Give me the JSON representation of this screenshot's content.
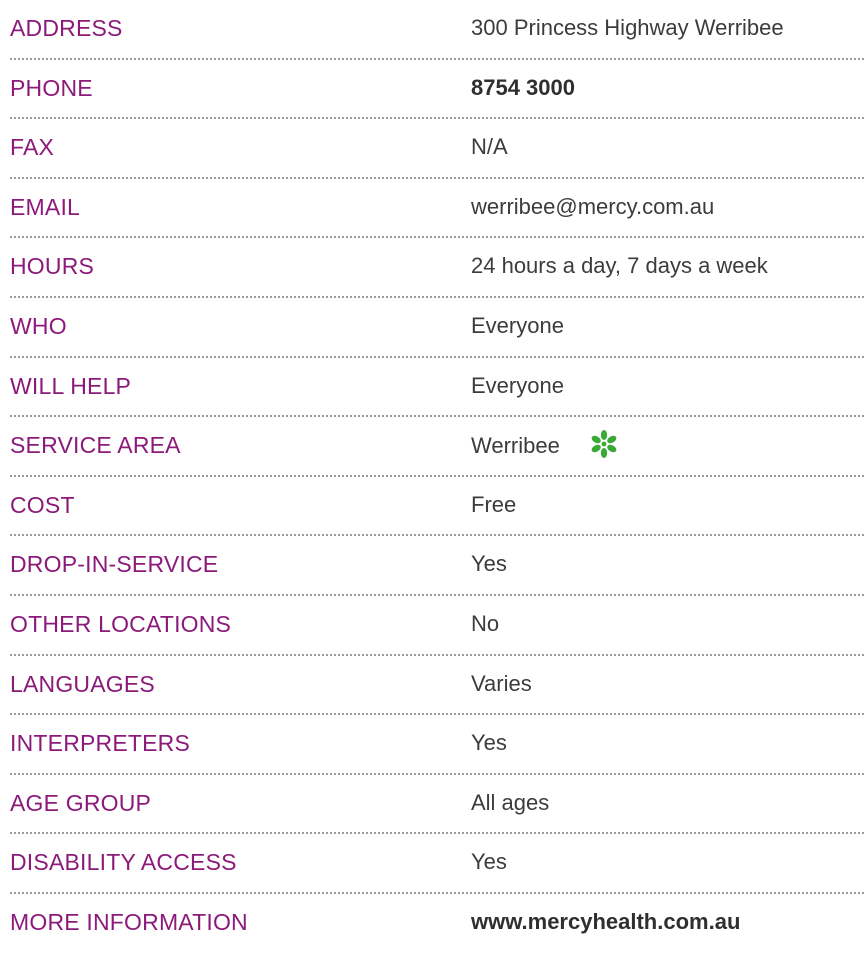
{
  "rows": [
    {
      "label": "ADDRESS",
      "value": "300 Princess Highway Werribee",
      "bold": false
    },
    {
      "label": "PHONE",
      "value": "8754 3000",
      "bold": true
    },
    {
      "label": "FAX",
      "value": "N/A",
      "bold": false
    },
    {
      "label": "EMAIL",
      "value": "werribee@mercy.com.au",
      "bold": false
    },
    {
      "label": "HOURS",
      "value": "24 hours a day, 7 days a week",
      "bold": false
    },
    {
      "label": "WHO",
      "value": "Everyone",
      "bold": false
    },
    {
      "label": "WILL HELP",
      "value": "Everyone",
      "bold": false
    },
    {
      "label": "SERVICE AREA",
      "value": "Werribee",
      "bold": false,
      "icon": "green-flower-icon"
    },
    {
      "label": "COST",
      "value": "Free",
      "bold": false
    },
    {
      "label": "DROP-IN-SERVICE",
      "value": "Yes",
      "bold": false
    },
    {
      "label": "OTHER LOCATIONS",
      "value": "No",
      "bold": false
    },
    {
      "label": "LANGUAGES",
      "value": "Varies",
      "bold": false
    },
    {
      "label": "INTERPRETERS",
      "value": "Yes",
      "bold": false
    },
    {
      "label": "AGE GROUP",
      "value": "All ages",
      "bold": false
    },
    {
      "label": "DISABILITY ACCESS",
      "value": "Yes",
      "bold": false
    },
    {
      "label": "MORE INFORMATION",
      "value": "www.mercyhealth.com.au",
      "bold": true
    }
  ],
  "colors": {
    "label": "#8b1a7a",
    "value": "#3c3c3c",
    "divider": "#9a9a9a",
    "icon": "#3aa935"
  }
}
